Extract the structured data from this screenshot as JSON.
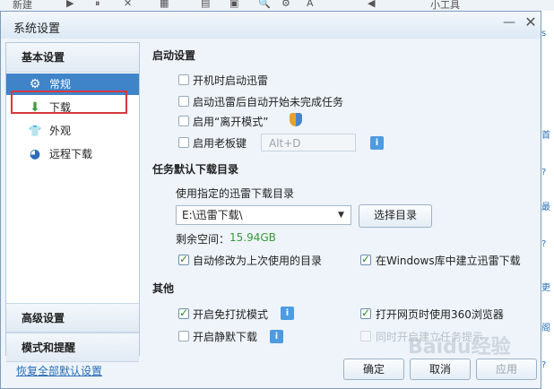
{
  "background": {
    "toolbar": [
      "新建",
      "▶",
      "⏸",
      "✕",
      "▦",
      "▤",
      "▣",
      "🔍",
      "⚙",
      "A",
      "◀",
      "小工具"
    ],
    "right_glyphs": [
      "s",
      "首",
      "?",
      "最",
      "?",
      "更",
      "阁",
      "?"
    ]
  },
  "dialog": {
    "title": "系统设置",
    "min_label": "—",
    "close_label": "✕"
  },
  "sidebar": {
    "basic_header": "基本设置",
    "items": [
      {
        "label": "常规",
        "icon": "gear-icon",
        "glyph": "⚙",
        "selected": true
      },
      {
        "label": "下载",
        "icon": "download-icon",
        "glyph": "⬇",
        "selected": false
      },
      {
        "label": "外观",
        "icon": "shirt-icon",
        "glyph": "👕",
        "selected": false
      },
      {
        "label": "远程下载",
        "icon": "globe-icon",
        "glyph": "◕",
        "selected": false
      }
    ],
    "advanced_header": "高级设置",
    "mode_header": "模式和提醒"
  },
  "startup": {
    "heading": "启动设置",
    "options": [
      {
        "label": "开机时启动迅雷",
        "checked": false
      },
      {
        "label": "启动迅雷后自动开始未完成任务",
        "checked": false
      },
      {
        "label": "启用“离开模式”",
        "checked": false
      },
      {
        "label": "启用老板键",
        "checked": false
      }
    ],
    "hotkey_value": "Alt+D"
  },
  "download_dir": {
    "heading": "任务默认下载目录",
    "use_label": "使用指定的迅雷下载目录",
    "path": "E:\\迅雷下载\\",
    "choose_label": "选择目录",
    "free_label": "剩余空间：",
    "free_value": "15.94GB",
    "auto_last_label": "自动修改为上次使用的目录",
    "auto_last_checked": true,
    "windows_lib_label": "在Windows库中建立迅雷下载",
    "windows_lib_checked": true
  },
  "other": {
    "heading": "其他",
    "dnd_label": "开启免打扰模式",
    "dnd_checked": true,
    "browser360_label": "打开网页时使用360浏览器",
    "browser360_checked": true,
    "silent_label": "开启静默下载",
    "silent_checked": false,
    "sync_label": "同时开启建立任务提示",
    "sync_checked": false
  },
  "footer": {
    "restore_label": "恢复全部默认设置",
    "ok_label": "确定",
    "cancel_label": "取消",
    "apply_label": "应用",
    "watermark": "Baidu经验"
  }
}
